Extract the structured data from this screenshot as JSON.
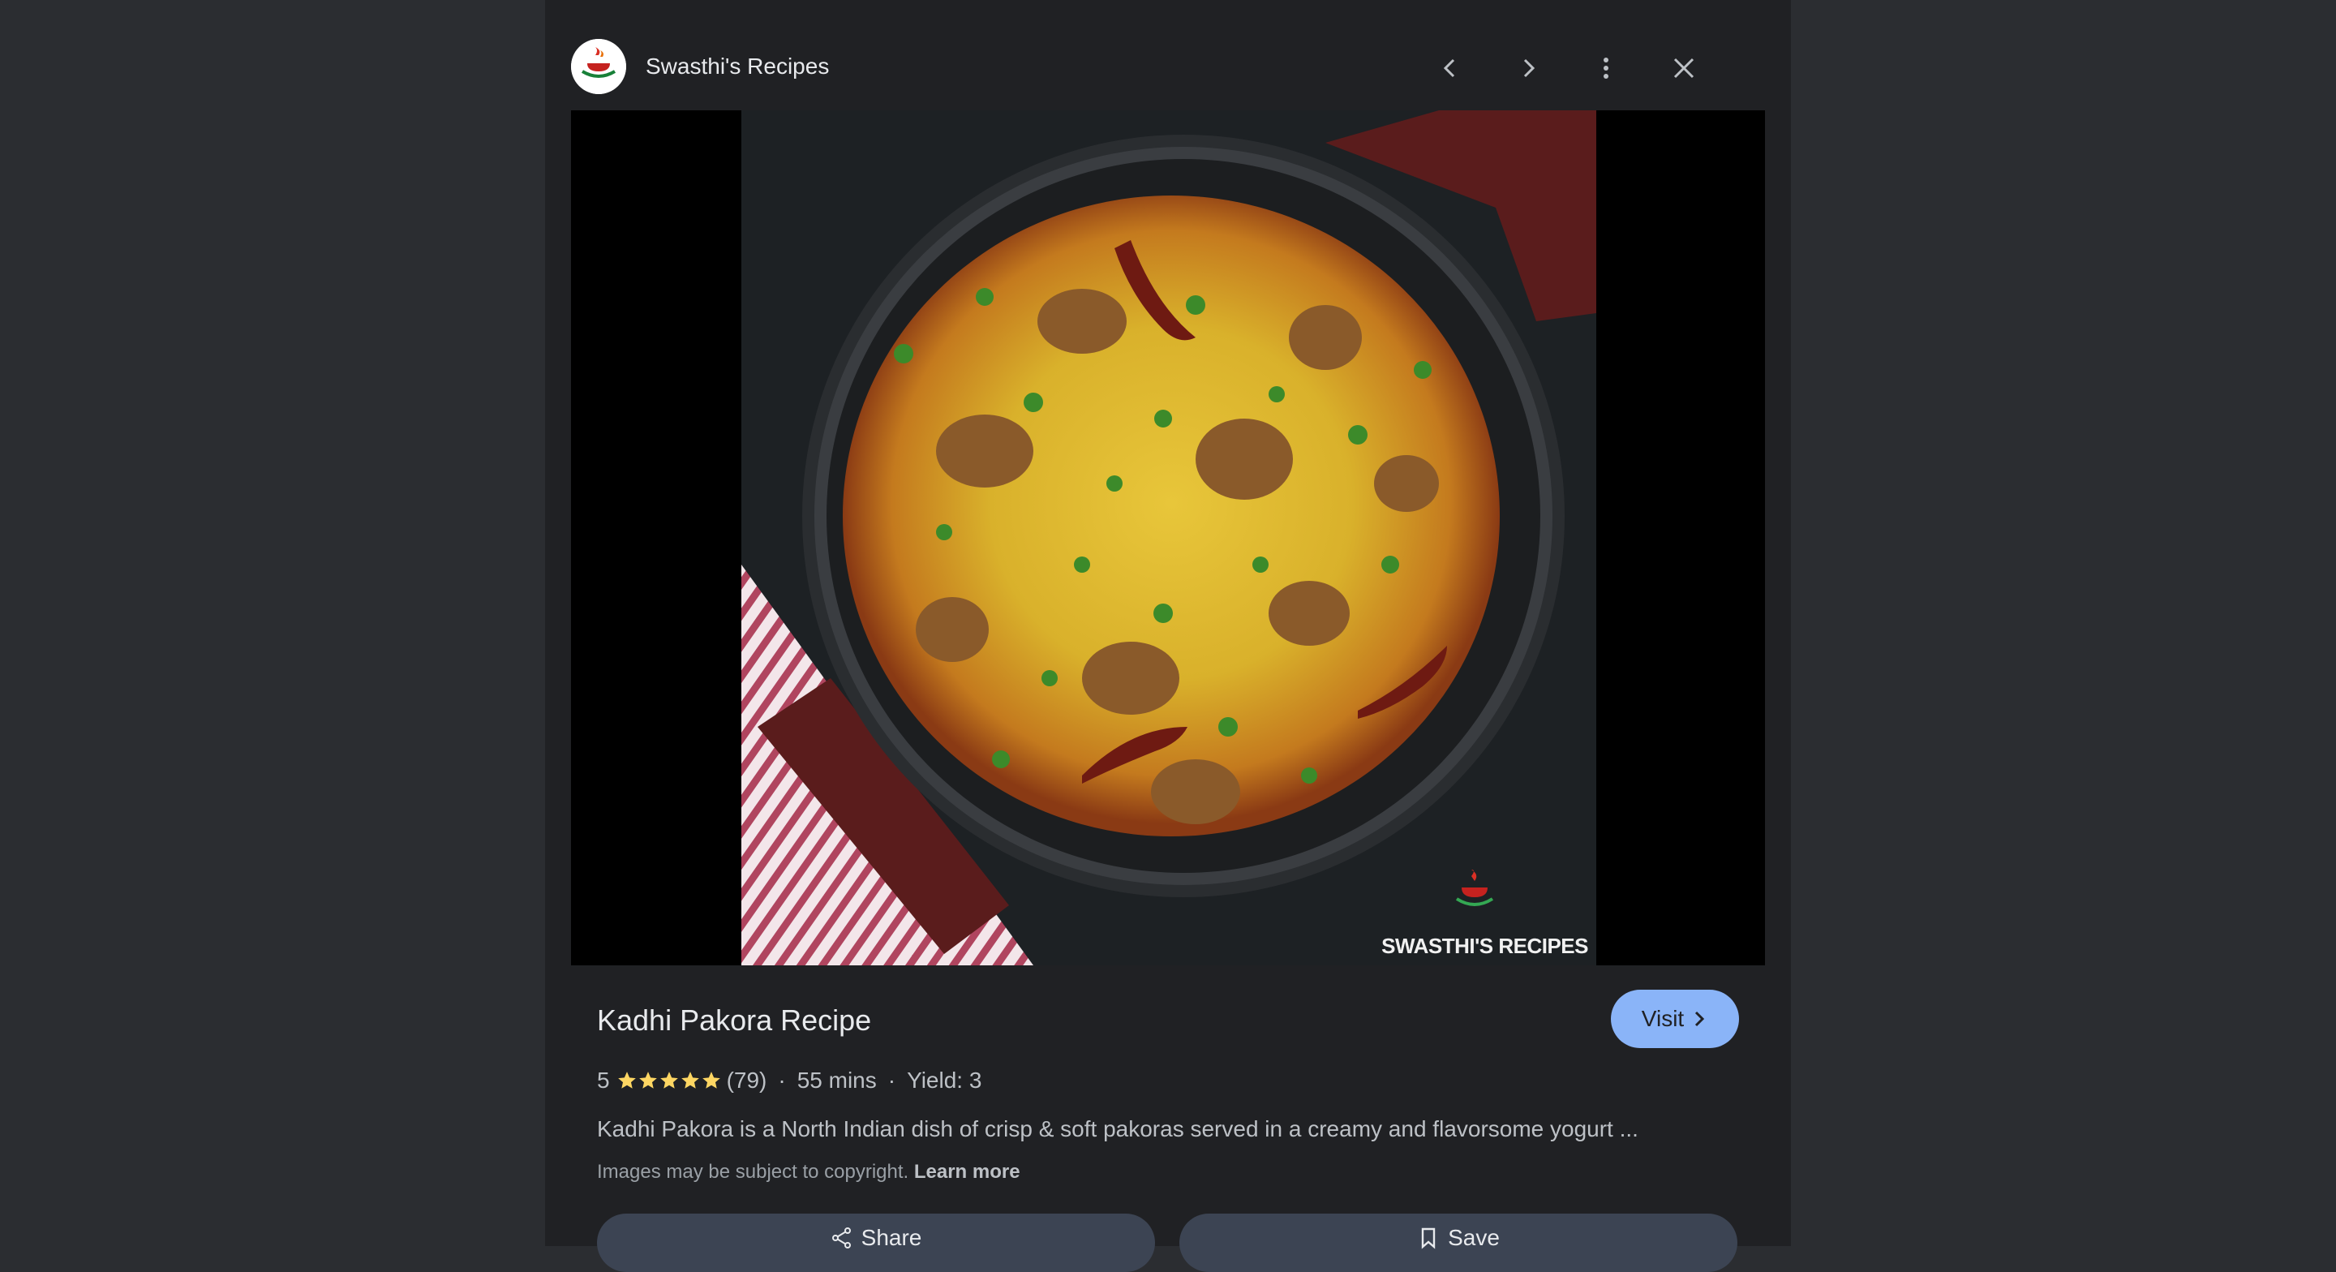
{
  "header": {
    "source_name": "Swasthi's Recipes",
    "icons": [
      "site-logo-icon",
      "chevron-left-icon",
      "chevron-right-icon",
      "more-vert-icon",
      "close-icon"
    ]
  },
  "image": {
    "watermark_text": "SWASTHI'S RECIPES"
  },
  "result": {
    "title": "Kadhi Pakora Recipe",
    "visit_label": "Visit",
    "rating": "5",
    "stars": 5,
    "rating_count": "(79)",
    "time": "55 mins",
    "yield": "Yield: 3",
    "separator": "·",
    "description": "Kadhi Pakora is a North Indian dish of crisp & soft pakoras served in a creamy and flavorsome yogurt ...",
    "copyright_notice": "Images may be subject to copyright.",
    "learn_more": "Learn more"
  },
  "actions": {
    "share_label": "Share",
    "save_label": "Save"
  },
  "colors": {
    "page_bg": "#2b2d31",
    "panel_bg": "#202124",
    "accent": "#8ab4f8",
    "star": "#fdd663",
    "action_bg": "#3c4453"
  }
}
